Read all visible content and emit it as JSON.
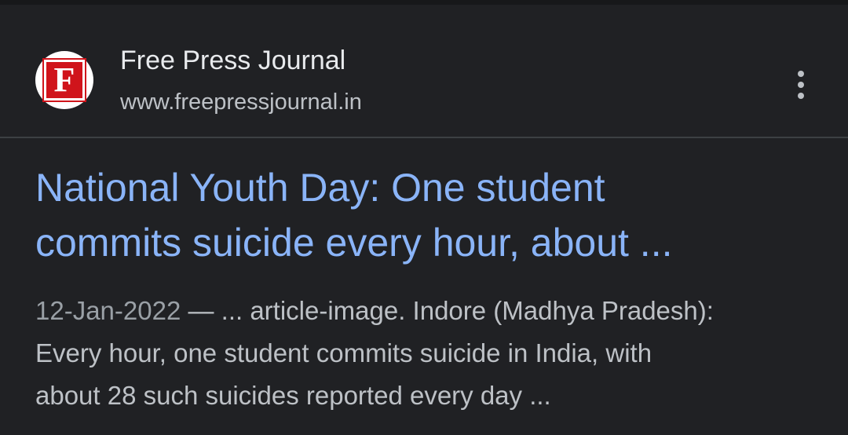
{
  "result": {
    "favicon_letter": "F",
    "site_name": "Free Press Journal",
    "site_url": "www.freepressjournal.in",
    "more_icon": "more-vert-icon",
    "headline_line1": "National Youth Day: One student",
    "headline_line2": "commits suicide every hour, about ...",
    "snippet_date": "12-Jan-2022",
    "snippet_line1_rest": " — ... article-image. Indore (Madhya Pradesh):",
    "snippet_line2": "Every hour, one student commits suicide in India, with",
    "snippet_line3": "about 28 such suicides reported every day ..."
  },
  "colors": {
    "background": "#202124",
    "headline": "#8ab4f8",
    "site_name": "#e8eaed",
    "snippet": "#bdc1c6",
    "favicon_red": "#d0141b"
  }
}
